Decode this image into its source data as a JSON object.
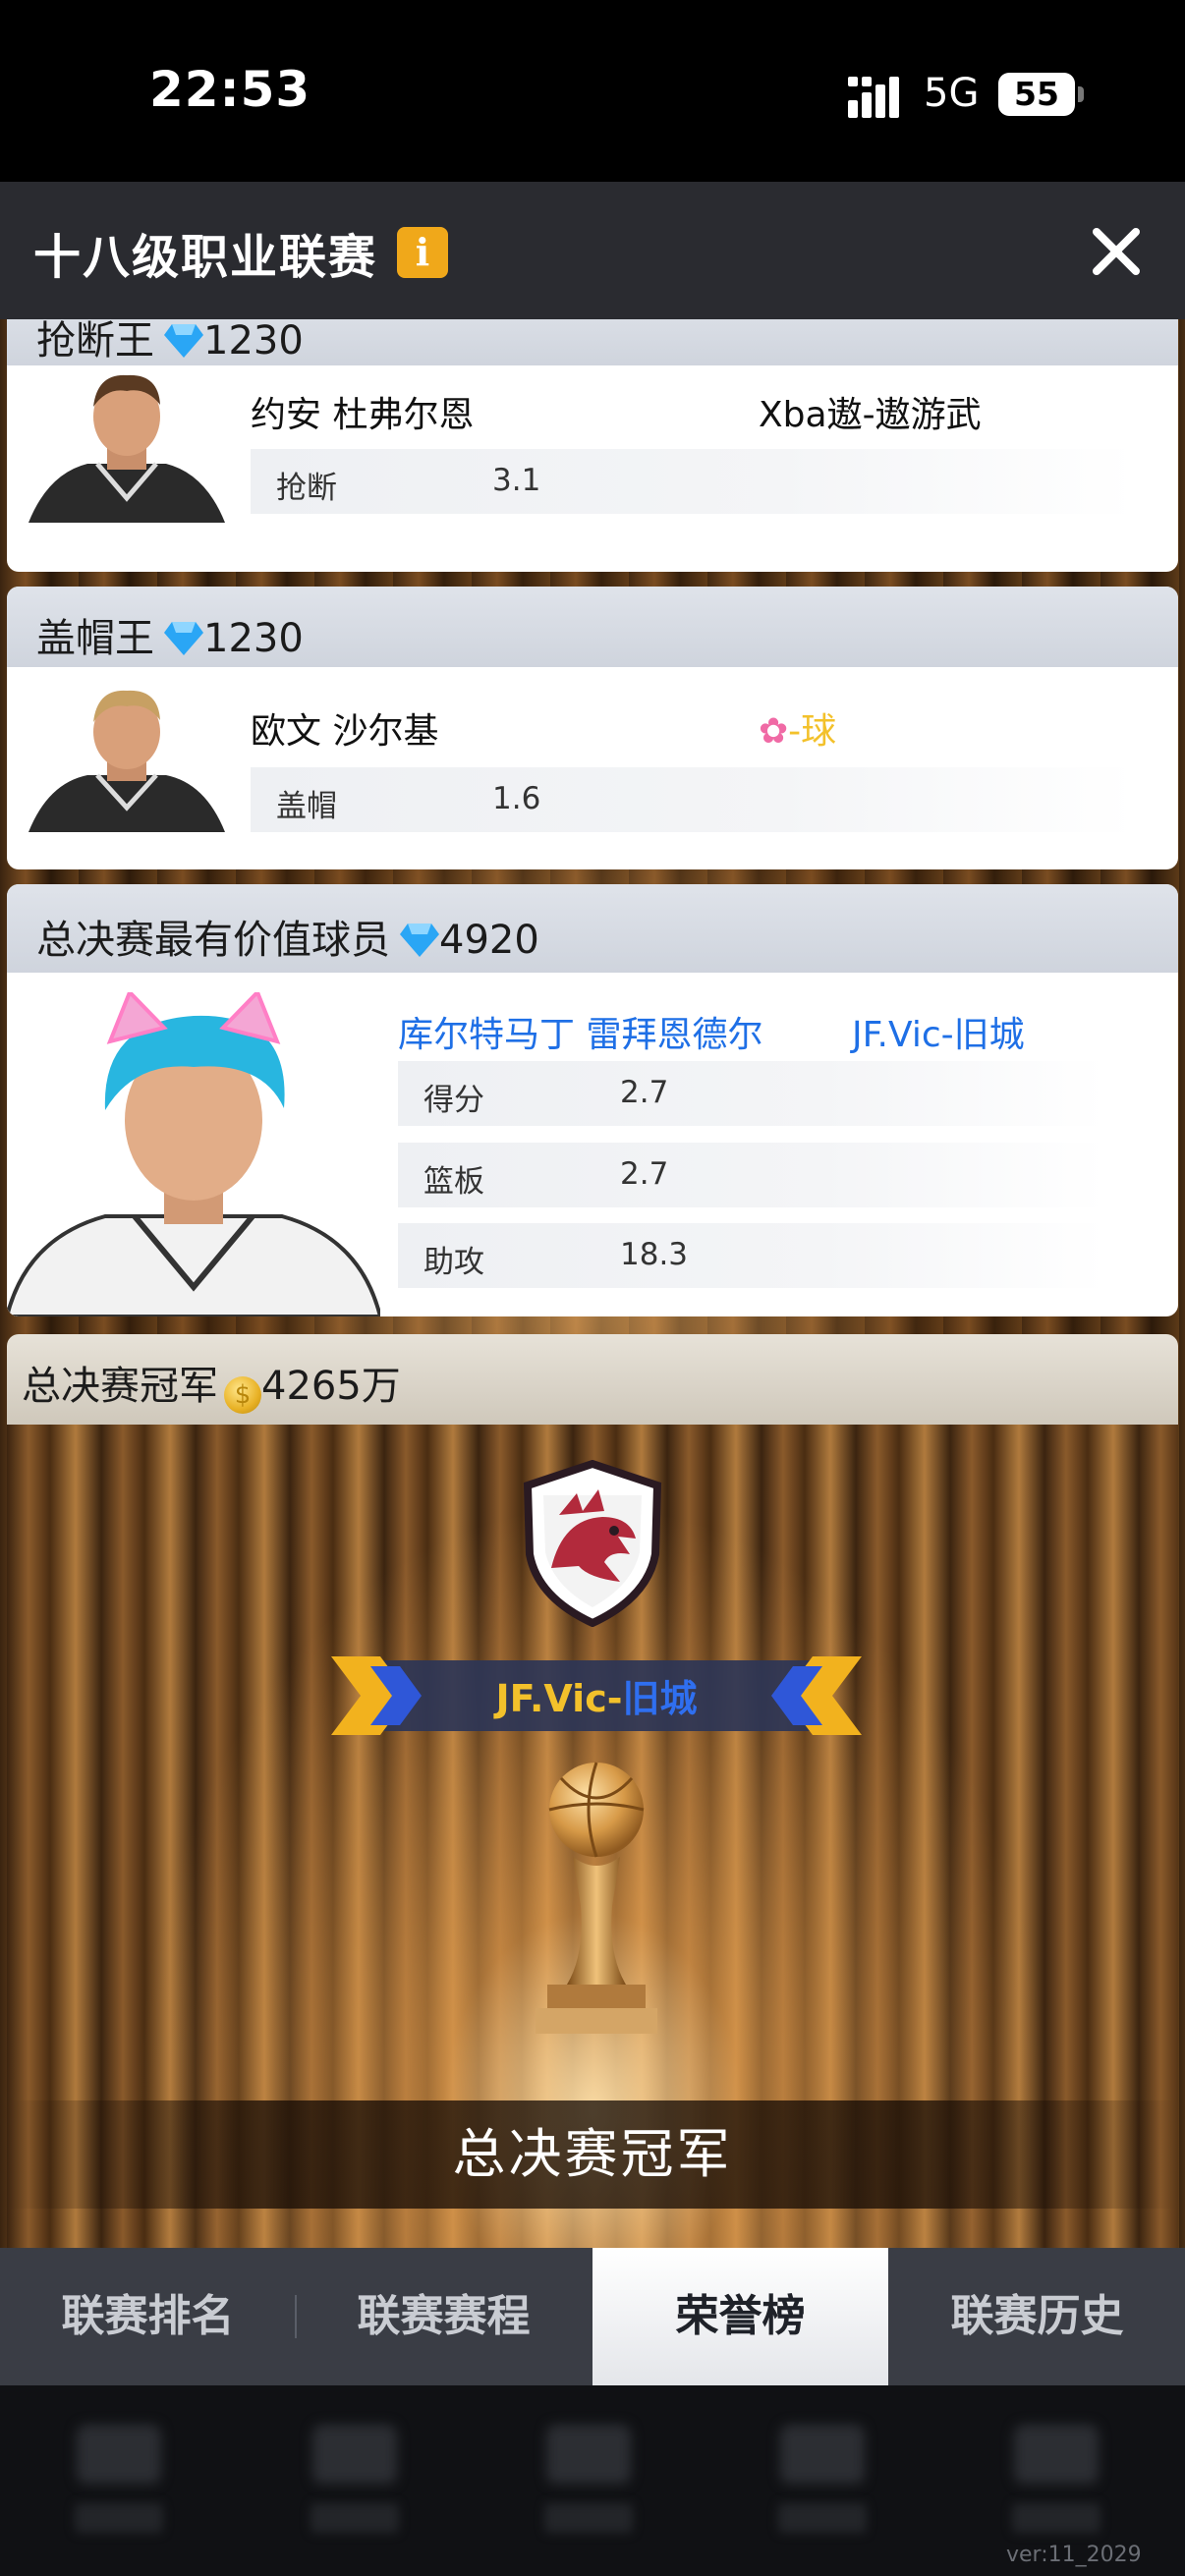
{
  "status_bar": {
    "time": "22:53",
    "network": "5G",
    "battery": "55"
  },
  "header": {
    "title": "十八级职业联赛",
    "info_icon": "i",
    "close_icon": "close-icon"
  },
  "awards": [
    {
      "title": "抢断王",
      "reward_icon": "diamond-icon",
      "reward": "1230",
      "player": "约安 杜弗尔恩",
      "team": "Xba遨-遨游武",
      "stats": [
        {
          "label": "抢断",
          "value": "3.1"
        }
      ]
    },
    {
      "title": "盖帽王",
      "reward_icon": "diamond-icon",
      "reward": "1230",
      "player": "欧文 沙尔基",
      "team_icon": "flower-icon",
      "team_prefix": "-",
      "team": "球",
      "stats": [
        {
          "label": "盖帽",
          "value": "1.6"
        }
      ]
    },
    {
      "title": "总决赛最有价值球员",
      "reward_icon": "diamond-icon",
      "reward": "4920",
      "player": "库尔特马丁 雷拜恩德尔",
      "team": "JF.Vic-旧城",
      "stats": [
        {
          "label": "得分",
          "value": "2.7"
        },
        {
          "label": "篮板",
          "value": "2.7"
        },
        {
          "label": "助攻",
          "value": "18.3"
        }
      ]
    }
  ],
  "champion": {
    "title": "总决赛冠军",
    "reward_icon": "coin-icon",
    "reward": "4265万",
    "team_prefix": "JF.Vic-",
    "team_suffix": "旧城",
    "label": "总决赛冠军"
  },
  "tabs": [
    {
      "label": "联赛排名",
      "active": false
    },
    {
      "label": "联赛赛程",
      "active": false
    },
    {
      "label": "荣誉榜",
      "active": true
    },
    {
      "label": "联赛历史",
      "active": false
    }
  ],
  "version": "ver:11_2029",
  "colors": {
    "accent_blue": "#1e6fe6",
    "gold": "#f3c12b",
    "info_orange": "#f0a81a",
    "tab_bg": "#3a3d45"
  }
}
